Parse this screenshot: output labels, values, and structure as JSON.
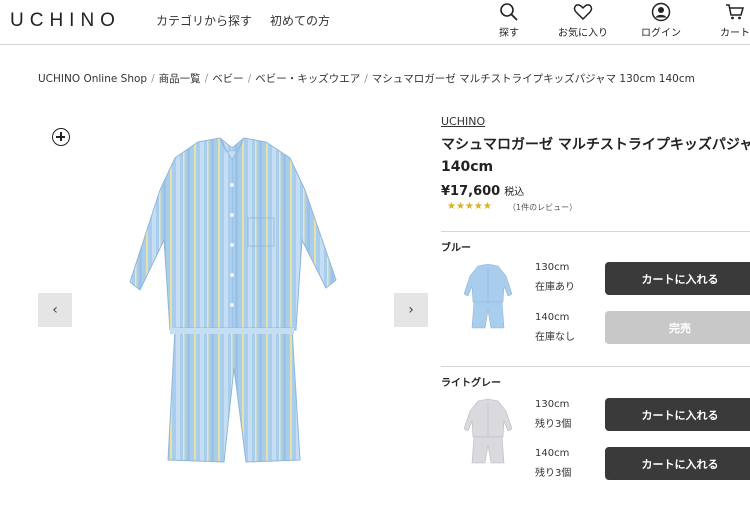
{
  "header": {
    "logo": "UCHINO",
    "nav": [
      "カテゴリから探す",
      "初めての方"
    ],
    "icons": [
      {
        "name": "search-icon",
        "label": "探す"
      },
      {
        "name": "heart-icon",
        "label": "お気に入り"
      },
      {
        "name": "user-icon",
        "label": "ログイン"
      },
      {
        "name": "cart-icon",
        "label": "カート"
      }
    ]
  },
  "breadcrumb": [
    "UCHINO Online Shop",
    "商品一覧",
    "ベビー",
    "ベビー・キッズウエア",
    "マシュマロガーゼ マルチストライプキッズパジャマ 130cm 140cm"
  ],
  "product": {
    "brand": "UCHINO",
    "title_line1": "マシュマロガーゼ マルチストライプキッズパジャマ",
    "title_line2": "140cm",
    "price": "¥17,600",
    "tax": "税込",
    "stars": "★★★★★",
    "review": "（1件のレビュー）"
  },
  "colors": [
    {
      "name": "ブルー",
      "variants": [
        {
          "size": "130cm",
          "stock": "在庫あり",
          "button": "カートに入れる"
        },
        {
          "size": "140cm",
          "stock": "在庫なし",
          "button": "完売"
        }
      ]
    },
    {
      "name": "ライトグレー",
      "variants": [
        {
          "size": "130cm",
          "stock": "残り3個",
          "button": "カートに入れる"
        },
        {
          "size": "140cm",
          "stock": "残り3個",
          "button": "カートに入れる"
        }
      ]
    }
  ],
  "carousel": {
    "prev": "‹",
    "next": "›"
  },
  "accent_colors": {
    "button": "#3a3a3a",
    "button_disabled": "#c8c8c8",
    "stars": "#d8b21f",
    "pajama_blue": "#a9cdec",
    "pajama_grey": "#d9d9de"
  }
}
